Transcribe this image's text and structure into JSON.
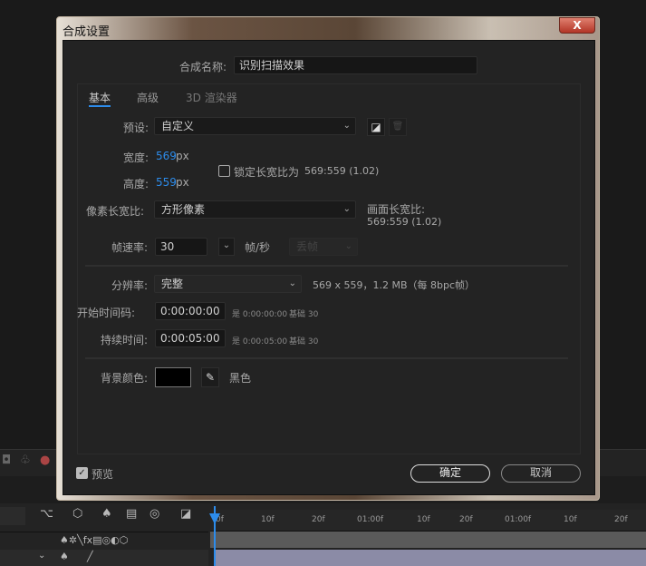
{
  "dialog": {
    "title": "合成设置",
    "close_label": "X",
    "comp_name_label": "合成名称:",
    "comp_name_value": "识别扫描效果",
    "tabs": [
      {
        "label": "基本",
        "active": true
      },
      {
        "label": "高级",
        "active": false
      },
      {
        "label": "3D 渲染器",
        "active": false
      }
    ],
    "preset_label": "预设:",
    "preset_value": "自定义",
    "width_label": "宽度:",
    "width_value": "569",
    "height_label": "高度:",
    "height_value": "559",
    "unit_px": "px",
    "lock_aspect_label": "锁定长宽比为",
    "lock_aspect_value": "569:559 (1.02)",
    "lock_aspect_checked": false,
    "pixel_aspect_label": "像素长宽比:",
    "pixel_aspect_value": "方形像素",
    "frame_aspect_label": "画面长宽比:",
    "frame_aspect_value": "569:559 (1.02)",
    "frame_rate_label": "帧速率:",
    "frame_rate_value": "30",
    "frame_rate_unit": "帧/秒",
    "drop_frame_value": "丢帧",
    "resolution_label": "分辨率:",
    "resolution_value": "完整",
    "resolution_info": "569 x 559，1.2 MB（每 8bpc帧）",
    "start_tc_label": "开始时间码:",
    "start_tc_value": "0:00:00:00",
    "start_tc_info": "是 0:00:00:00",
    "start_tc_base": "基础 30",
    "duration_label": "持续时间:",
    "duration_value": "0:00:05:00",
    "duration_info": "是 0:00:05:00",
    "duration_base": "基础 30",
    "bg_color_label": "背景颜色:",
    "bg_color": "#000000",
    "bg_color_name": "黑色",
    "preview_label": "预览",
    "preview_checked": true,
    "ok_label": "确定",
    "cancel_label": "取消"
  },
  "timeline": {
    "ruler": [
      "0f",
      "10f",
      "20f",
      "01:00f",
      "10f",
      "20f",
      "01:00f",
      "10f",
      "20f"
    ]
  },
  "colors": {
    "accent": "#2d8ceb"
  }
}
